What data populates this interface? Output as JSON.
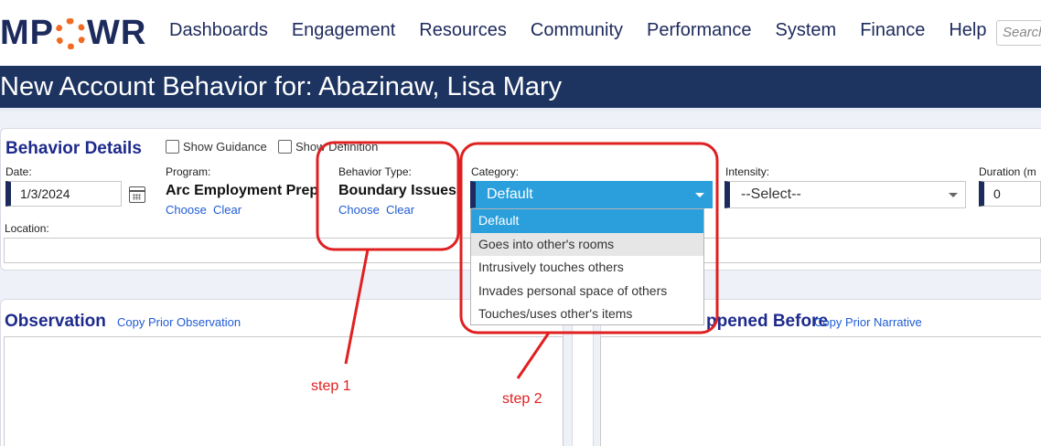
{
  "app": {
    "logo_text_left": "MP",
    "logo_text_right": "WR",
    "nav_items": [
      "Dashboards",
      "Engagement",
      "Resources",
      "Community",
      "Performance",
      "System",
      "Finance",
      "Help"
    ],
    "search_placeholder": "Search"
  },
  "page": {
    "title": "New Account Behavior for: Abazinaw, Lisa Mary"
  },
  "details": {
    "section_title": "Behavior Details",
    "show_guidance_label": "Show Guidance",
    "show_definition_label": "Show Definition",
    "date_label": "Date:",
    "date_value": "1/3/2024",
    "program_label": "Program:",
    "program_value": "Arc Employment Prep",
    "program_choose": "Choose",
    "program_clear": "Clear",
    "behavior_type_label": "Behavior Type:",
    "behavior_type_value": "Boundary Issues",
    "behavior_choose": "Choose",
    "behavior_clear": "Clear",
    "category_label": "Category:",
    "category_value": "Default",
    "category_options": [
      "Default",
      "Goes into other's rooms",
      "Intrusively touches others",
      "Invades personal space of others",
      "Touches/uses other's items"
    ],
    "intensity_label": "Intensity:",
    "intensity_value": "--Select--",
    "duration_label": "Duration (m",
    "duration_value": "0",
    "location_label": "Location:"
  },
  "observation": {
    "title": "Observation",
    "copy_link": "Copy Prior Observation"
  },
  "happened_before": {
    "title_visible": "ppened Before",
    "copy_link": "Copy Prior Narrative"
  },
  "annotations": {
    "step1": "step 1",
    "step2": "step 2",
    "color": "#e02020"
  },
  "colors": {
    "navy": "#1d2a5c",
    "title_bar": "#1d3461",
    "accent_blue": "#2a9fdc",
    "link_blue": "#1f5bd4",
    "logo_orange": "#f26a21"
  }
}
